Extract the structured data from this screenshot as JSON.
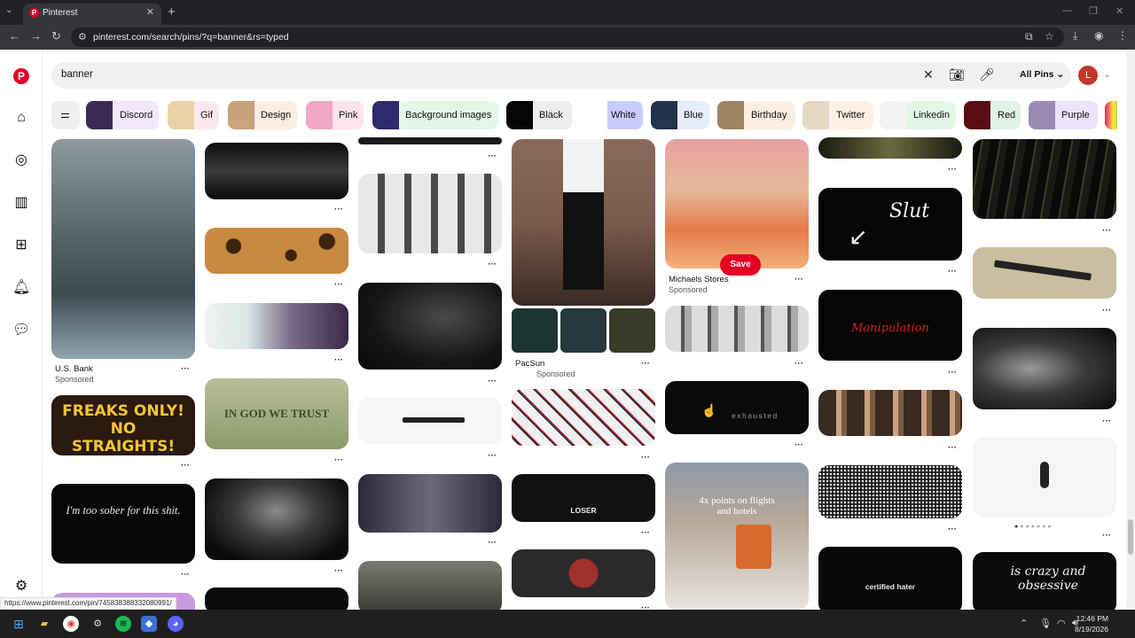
{
  "browser": {
    "tab_title": "Pinterest",
    "url": "pinterest.com/search/pins/?q=banner&rs=typed",
    "status_url": "https://www.pinterest.com/pin/745838388332080991/"
  },
  "search": {
    "query": "banner",
    "scope": "All Pins",
    "avatar_letter": "L"
  },
  "chips": [
    {
      "label": "Discord",
      "color": "#f3e8fb",
      "thumb": "#3a2a55"
    },
    {
      "label": "Gif",
      "color": "#fde8f0",
      "thumb": "#e9d3a6"
    },
    {
      "label": "Design",
      "color": "#fdece2",
      "thumb": "#c9a27a"
    },
    {
      "label": "Pink",
      "color": "#fde4ee",
      "thumb": "#f2a7c4"
    },
    {
      "label": "Background images",
      "color": "#e3f7e9",
      "thumb": "#2f2a6b"
    },
    {
      "label": "Black",
      "color": "#ededed",
      "thumb": "#050505"
    },
    {
      "label": "White",
      "color": "#c9ccfb",
      "thumb": "#ffffff"
    },
    {
      "label": "Blue",
      "color": "#e6ecfb",
      "thumb": "#22324f"
    },
    {
      "label": "Birthday",
      "color": "#fdeee4",
      "thumb": "#a08462"
    },
    {
      "label": "Twitter",
      "color": "#fdf0e4",
      "thumb": "#e7d8c4"
    },
    {
      "label": "Linkedin",
      "color": "#e3f7e9",
      "thumb": "#f3f3f3"
    },
    {
      "label": "Red",
      "color": "#dff3e6",
      "thumb": "#5a0a10"
    },
    {
      "label": "Purple",
      "color": "#ece4fb",
      "thumb": "#9a8bb6"
    }
  ],
  "pins": {
    "usbank_title": "U.S. Bank",
    "usbank_sub": "Sponsored",
    "pacsun_title": "PacSun",
    "pacsun_sub": "Sponsored",
    "michaels_title": "Michaels Stores",
    "michaels_sub": "Sponsored",
    "freaks_text": "FREAKS ONLY! NO STRAIGHTS!",
    "sober_text": "I'm too sober for this shit.",
    "trust_text": "IN GOD WE TRUST",
    "loser_text": "LOSER",
    "exhausted_text": "exhausted",
    "points_text": "4x points on flights and hotels",
    "slut_text": "Slut",
    "manipulation_text": "Manipulation",
    "hater_text": "certified hater",
    "crazy_text": "is crazy and obsessive",
    "save_label": "Save"
  },
  "taskbar": {
    "time": "12:46 PM",
    "date": "8/19/2026"
  }
}
